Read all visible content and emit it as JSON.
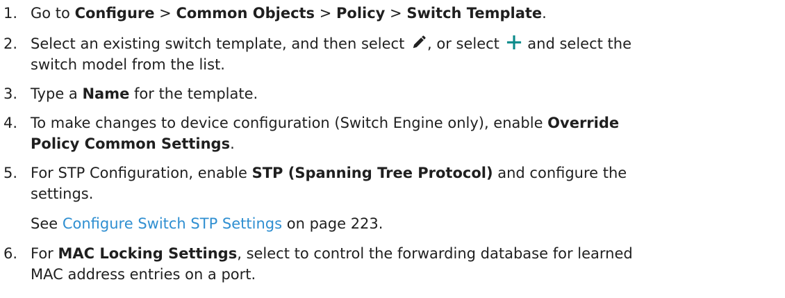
{
  "steps": [
    {
      "number": "1.",
      "segments": {
        "go_to": "Go to ",
        "configure": "Configure",
        "sep1": " > ",
        "common_objects": "Common Objects",
        "sep2": " > ",
        "policy": "Policy",
        "sep3": " > ",
        "switch_template": "Switch Template",
        "end": "."
      }
    },
    {
      "number": "2.",
      "line1_before_pencil": "Select an existing switch template, and then select ",
      "line1_between_icons": ", or select ",
      "line1_after_plus": " and select the",
      "line2": "switch model from the list."
    },
    {
      "number": "3.",
      "before": "Type a ",
      "bold": "Name",
      "after": " for the template."
    },
    {
      "number": "4.",
      "line1_before": "To make changes to device configuration (Switch Engine only), enable ",
      "line1_bold": "Override",
      "line2_bold": "Policy Common Settings",
      "line2_after": "."
    },
    {
      "number": "5.",
      "line1_before": "For STP Configuration, enable ",
      "line1_bold": "STP (Spanning Tree Protocol)",
      "line1_after": " and configure the",
      "line2": "settings.",
      "see": "See ",
      "link": "Configure Switch STP Settings",
      "page_ref": " on page 223."
    },
    {
      "number": "6.",
      "line1_before": "For ",
      "line1_bold": "MAC Locking Settings",
      "line1_after": ", select to control the forwarding database for learned",
      "line2": "MAC address entries on a port."
    }
  ],
  "colors": {
    "text": "#1f1f1f",
    "link": "#2f8fd1",
    "icon_pencil": "#222222",
    "icon_plus": "#0a8a8a"
  },
  "icons": {
    "edit": "pencil-icon",
    "add": "plus-icon"
  }
}
